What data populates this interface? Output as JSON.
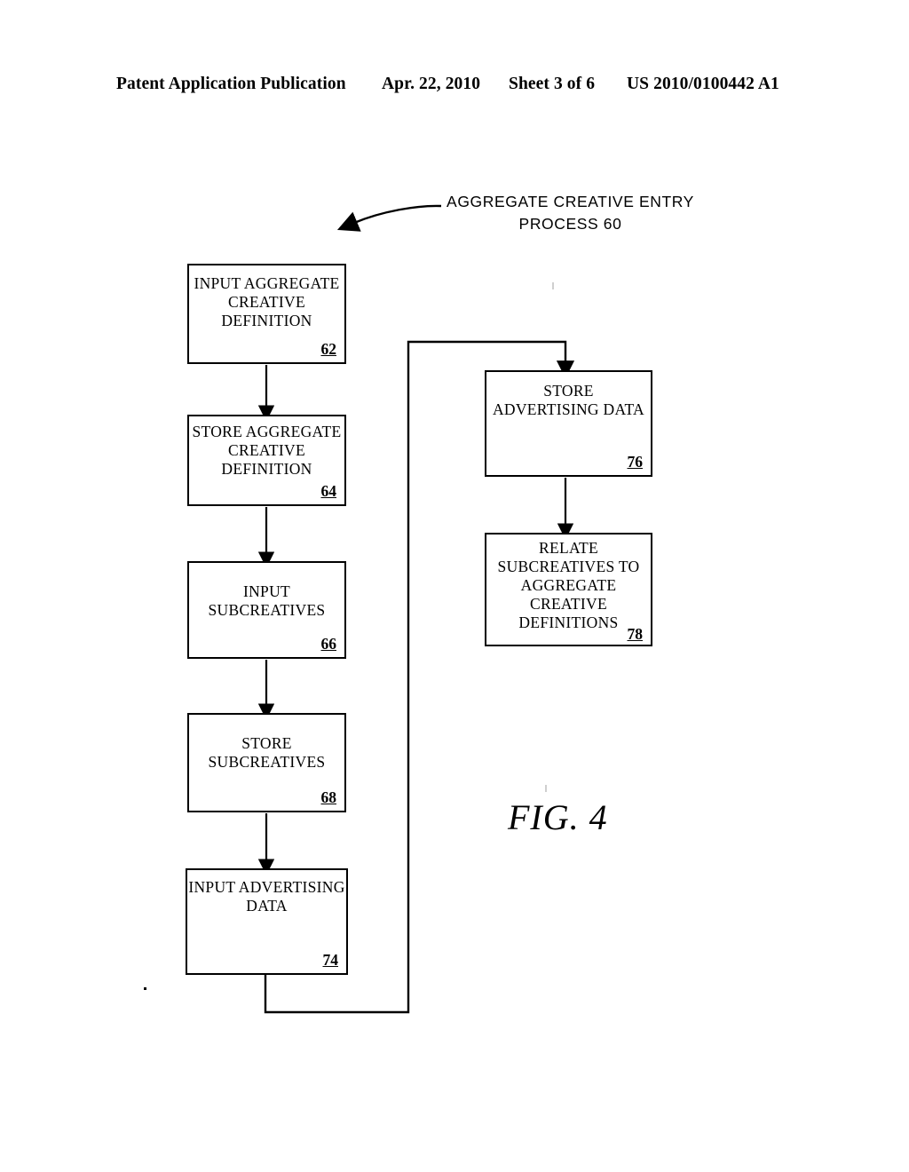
{
  "header": {
    "publication": "Patent Application Publication",
    "date": "Apr. 22, 2010",
    "sheet": "Sheet 3 of 6",
    "pub_number": "US 2010/0100442 A1"
  },
  "figure": {
    "label": "FIG. 4",
    "title_lines": [
      "AGGREGATE CREATIVE ENTRY",
      "PROCESS 60"
    ],
    "title_full": "AGGREGATE CREATIVE ENTRY PROCESS 60",
    "process_number": "60"
  },
  "diagram": {
    "type": "flowchart",
    "boxes": [
      {
        "id": "62",
        "ref": "62",
        "lines": [
          "INPUT AGGREGATE",
          "CREATIVE",
          "DEFINITION"
        ],
        "text": "INPUT AGGREGATE CREATIVE DEFINITION",
        "column": "left"
      },
      {
        "id": "64",
        "ref": "64",
        "lines": [
          "STORE AGGREGATE",
          "CREATIVE",
          "DEFINITION"
        ],
        "text": "STORE AGGREGATE CREATIVE DEFINITION",
        "column": "left"
      },
      {
        "id": "66",
        "ref": "66",
        "lines": [
          "INPUT",
          "SUBCREATIVES"
        ],
        "text": "INPUT SUBCREATIVES",
        "column": "left"
      },
      {
        "id": "68",
        "ref": "68",
        "lines": [
          "STORE",
          "SUBCREATIVES"
        ],
        "text": "STORE SUBCREATIVES",
        "column": "left"
      },
      {
        "id": "74",
        "ref": "74",
        "lines": [
          "INPUT ADVERTISING",
          "DATA"
        ],
        "text": "INPUT ADVERTISING DATA",
        "column": "left"
      },
      {
        "id": "76",
        "ref": "76",
        "lines": [
          "STORE",
          "ADVERTISING DATA"
        ],
        "text": "STORE ADVERTISING DATA",
        "column": "right"
      },
      {
        "id": "78",
        "ref": "78",
        "lines": [
          "RELATE",
          "SUBCREATIVES TO",
          "AGGREGATE",
          "CREATIVE",
          "DEFINITIONS"
        ],
        "text": "RELATE SUBCREATIVES TO AGGREGATE CREATIVE DEFINITIONS",
        "column": "right"
      }
    ],
    "connections": [
      {
        "from": "62",
        "to": "64",
        "style": "straight-down-arrow"
      },
      {
        "from": "64",
        "to": "66",
        "style": "straight-down-arrow"
      },
      {
        "from": "66",
        "to": "68",
        "style": "straight-down-arrow"
      },
      {
        "from": "68",
        "to": "74",
        "style": "straight-down-arrow"
      },
      {
        "from": "74",
        "to": "76",
        "style": "routed-right-up-arrow"
      },
      {
        "from": "76",
        "to": "78",
        "style": "straight-down-arrow"
      }
    ],
    "title_pointer": {
      "from": "figure-title",
      "to": "diagram",
      "style": "curved-arrow-left"
    }
  }
}
